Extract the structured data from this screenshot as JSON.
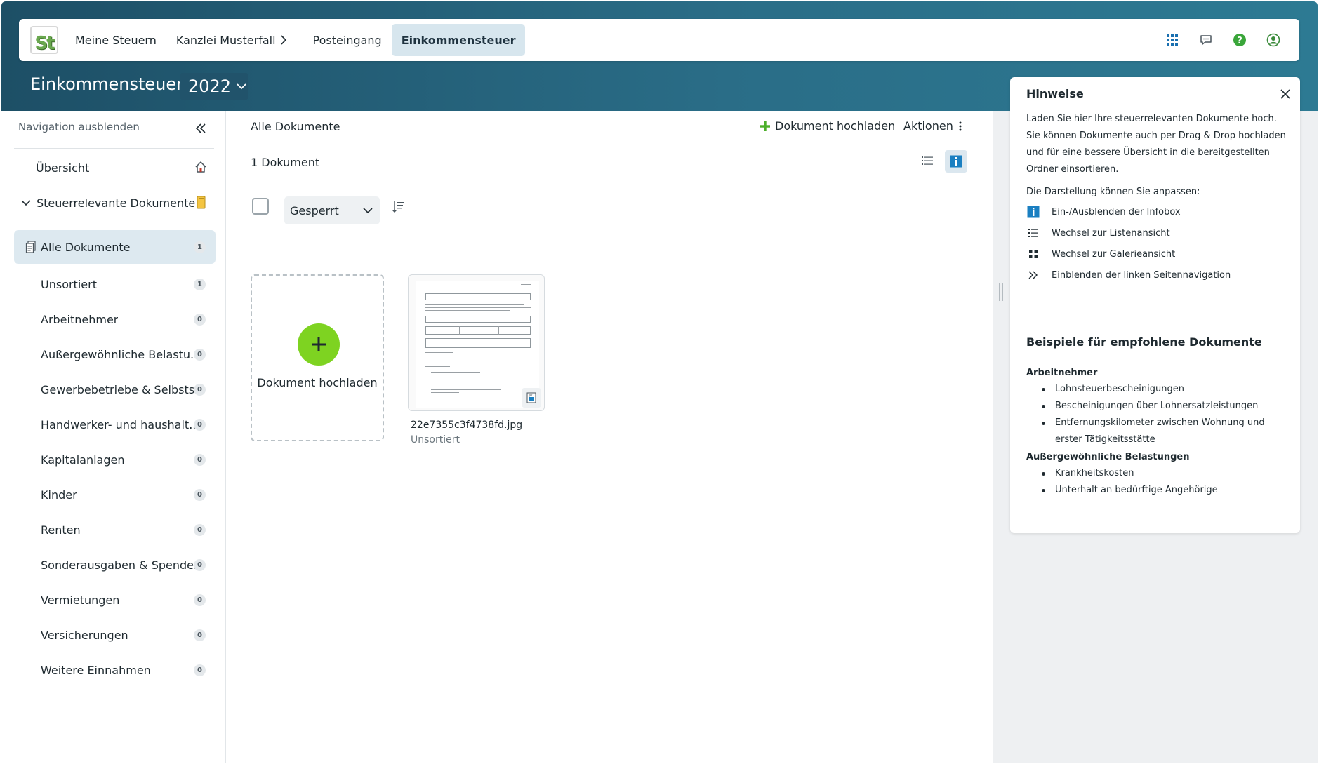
{
  "topbar": {
    "logo_text": "St",
    "nav": [
      {
        "label": "Meine Steuern"
      },
      {
        "label": "Kanzlei Musterfall"
      },
      {
        "label": "Posteingang"
      },
      {
        "label": "Einkommensteuer"
      }
    ],
    "icons": [
      "apps-grid-icon",
      "chat-icon",
      "help-icon",
      "user-icon"
    ]
  },
  "page": {
    "title": "Einkommensteuer",
    "year": "2022"
  },
  "sidebar": {
    "toggle_label": "Navigation ausblenden",
    "overview_label": "Übersicht",
    "group_label": "Steuerrelevante Dokumente",
    "items": [
      {
        "label": "Alle Dokumente",
        "count": "1"
      },
      {
        "label": "Unsortiert",
        "count": "1"
      },
      {
        "label": "Arbeitnehmer",
        "count": "0"
      },
      {
        "label": "Außergewöhnliche Belastu...",
        "count": "0"
      },
      {
        "label": "Gewerbebetriebe & Selbsts...",
        "count": "0"
      },
      {
        "label": "Handwerker- und haushalt...",
        "count": "0"
      },
      {
        "label": "Kapitalanlagen",
        "count": "0"
      },
      {
        "label": "Kinder",
        "count": "0"
      },
      {
        "label": "Renten",
        "count": "0"
      },
      {
        "label": "Sonderausgaben & Spenden",
        "count": "0"
      },
      {
        "label": "Vermietungen",
        "count": "0"
      },
      {
        "label": "Versicherungen",
        "count": "0"
      },
      {
        "label": "Weitere Einnahmen",
        "count": "0"
      }
    ]
  },
  "main": {
    "title": "Alle Dokumente",
    "upload_label": "Dokument hochladen",
    "actions_label": "Aktionen",
    "doc_count": "1 Dokument",
    "sort_value": "Gesperrt",
    "upload_tile_label": "Dokument hochladen",
    "documents": [
      {
        "name": "22e7355c3f4738fd.jpg",
        "status": "Unsortiert"
      }
    ]
  },
  "hints": {
    "title": "Hinweise",
    "text": "Laden Sie hier Ihre steuerrelevanten Dokumente hoch. Sie können Dokumente auch per Drag & Drop hochladen und für eine bessere Übersicht in die bereitgestellten Ordner einsortieren.",
    "sub": "Die Darstellung können Sie anpassen:",
    "rows": [
      {
        "label": "Ein-/Ausblenden der Infobox"
      },
      {
        "label": "Wechsel zur Listenansicht"
      },
      {
        "label": "Wechsel zur Galerieansicht"
      },
      {
        "label": "Einblenden der linken Seitennavigation"
      }
    ],
    "examples_title": "Beispiele für empfohlene Dokumente",
    "sections": [
      {
        "title": "Arbeitnehmer",
        "items": [
          "Lohnsteuerbescheinigungen",
          "Bescheinigungen über Lohnersatzleistungen",
          "Entfernungskilometer zwischen Wohnung und erster Tätigkeitsstätte"
        ]
      },
      {
        "title": "Außergewöhnliche Belastungen",
        "items": [
          "Krankheitskosten",
          "Unterhalt an bedürftige Angehörige"
        ]
      }
    ]
  },
  "colors": {
    "header_dark": "#1d4f66",
    "accent_green": "#7ed321",
    "active_bg": "#dde9f0",
    "info_blue": "#1a7fc1"
  }
}
